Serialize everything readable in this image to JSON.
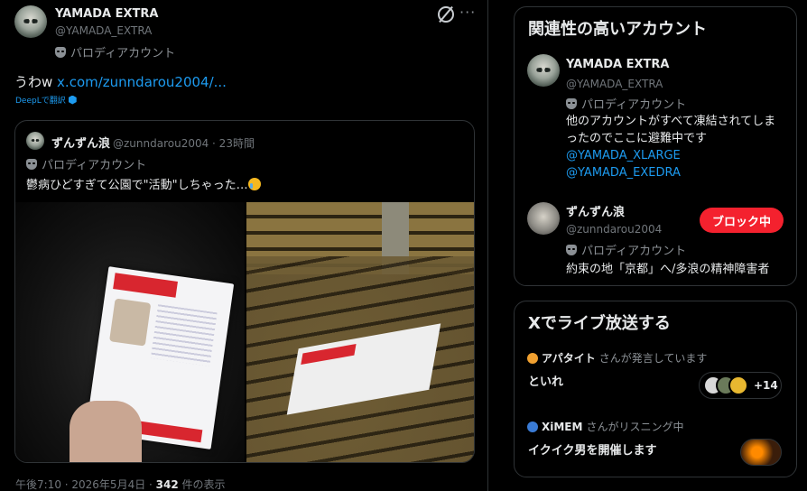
{
  "tweet": {
    "author_name": "YAMADA EXTRA ",
    "author_handle": "@YAMADA_EXTRA",
    "parody_label": "パロディアカウント",
    "text_prefix": "うわw ",
    "link_text": "x.com/zunndarou2004/...",
    "translate_label": "DeepLで翻訳",
    "meta_time": "午後7:10 · 2026年5月4日 · ",
    "views_count": "342",
    "views_suffix": " 件の表示"
  },
  "quote": {
    "author_name": "ずんずん浪",
    "handle_time": "@zunndarou2004 · 23時間",
    "parody_label": "パロディアカウント",
    "text": "鬱病ひどすぎて公園で\"活動\"しちゃった…"
  },
  "related": {
    "title": "関連性の高いアカウント",
    "accounts": [
      {
        "name": "YAMADA EXTRA ",
        "handle": "@YAMADA_EXTRA",
        "parody": "パロディアカウント",
        "bio": "他のアカウントがすべて凍結されてしまったのでここに避難中です",
        "links": [
          "@YAMADA_XLARGE",
          "@YAMADA_EXEDRA"
        ]
      },
      {
        "name": "ずんずん浪",
        "handle": "@zunndarou2004",
        "parody": "パロディアカウント",
        "bio": "約束の地「京都」へ/多浪の精神障害者",
        "button": "ブロック中"
      }
    ]
  },
  "live": {
    "title": "Xでライブ放送する",
    "spaces": [
      {
        "host": "アパタイト",
        "status": "さんが発言しています",
        "title": "といれ",
        "listeners_extra": "+14"
      },
      {
        "host": "XiMEM",
        "status": "さんがリスニング中",
        "title": "イクイク男を開催します"
      }
    ]
  },
  "colors": {
    "accent": "#1d9bf0",
    "danger": "#f4212e",
    "background": "#000000"
  }
}
